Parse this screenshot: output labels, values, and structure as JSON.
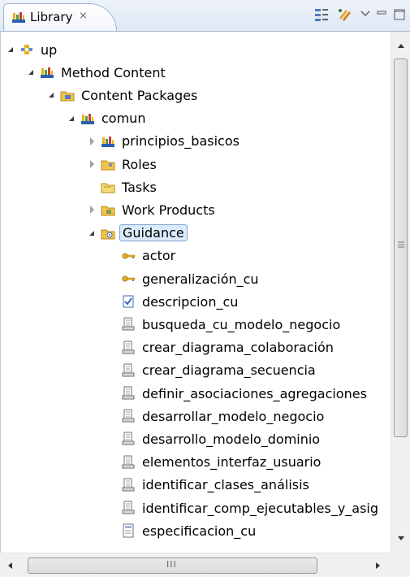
{
  "tab": {
    "label": "Library",
    "close": "⨯"
  },
  "tree": {
    "rows": [
      {
        "label": "up",
        "icon": "process-icon",
        "twisty": "open",
        "indent": 0
      },
      {
        "label": "Method Content",
        "icon": "library-icon",
        "twisty": "open",
        "indent": 1
      },
      {
        "label": "Content Packages",
        "icon": "package-folder-icon",
        "twisty": "open",
        "indent": 2
      },
      {
        "label": "comun",
        "icon": "library-icon",
        "twisty": "open",
        "indent": 3
      },
      {
        "label": "principios_basicos",
        "icon": "library-icon",
        "twisty": "closed",
        "indent": 4
      },
      {
        "label": "Roles",
        "icon": "roles-folder-icon",
        "twisty": "closed",
        "indent": 4
      },
      {
        "label": "Tasks",
        "icon": "tasks-folder-icon",
        "twisty": "none",
        "indent": 4
      },
      {
        "label": "Work Products",
        "icon": "workproducts-folder-icon",
        "twisty": "closed",
        "indent": 4
      },
      {
        "label": "Guidance",
        "icon": "guidance-folder-icon",
        "twisty": "open",
        "indent": 4,
        "selected": true
      },
      {
        "label": "actor",
        "icon": "key-icon",
        "twisty": "none",
        "indent": 5
      },
      {
        "label": "generalización_cu",
        "icon": "key-icon",
        "twisty": "none",
        "indent": 5
      },
      {
        "label": "descripcion_cu",
        "icon": "checklist-icon",
        "twisty": "none",
        "indent": 5
      },
      {
        "label": "busqueda_cu_modelo_negocio",
        "icon": "guideline-icon",
        "twisty": "none",
        "indent": 5
      },
      {
        "label": "crear_diagrama_colaboración",
        "icon": "guideline-icon",
        "twisty": "none",
        "indent": 5
      },
      {
        "label": "crear_diagrama_secuencia",
        "icon": "guideline-icon",
        "twisty": "none",
        "indent": 5
      },
      {
        "label": "definir_asociaciones_agregaciones",
        "icon": "guideline-icon",
        "twisty": "none",
        "indent": 5
      },
      {
        "label": "desarrollar_modelo_negocio",
        "icon": "guideline-icon",
        "twisty": "none",
        "indent": 5
      },
      {
        "label": "desarrollo_modelo_dominio",
        "icon": "guideline-icon",
        "twisty": "none",
        "indent": 5
      },
      {
        "label": "elementos_interfaz_usuario",
        "icon": "guideline-icon",
        "twisty": "none",
        "indent": 5
      },
      {
        "label": "identificar_clases_análisis",
        "icon": "guideline-icon",
        "twisty": "none",
        "indent": 5
      },
      {
        "label": "identificar_comp_ejecutables_y_asig",
        "icon": "guideline-icon",
        "twisty": "none",
        "indent": 5
      },
      {
        "label": "especificacion_cu",
        "icon": "template-icon",
        "twisty": "none",
        "indent": 5
      }
    ]
  },
  "hscroll": {
    "grip": "III"
  }
}
